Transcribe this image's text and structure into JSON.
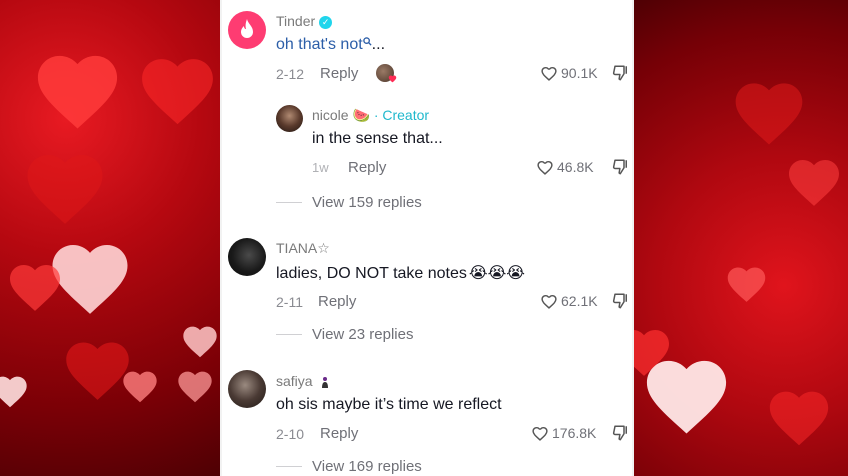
{
  "comments": [
    {
      "username": "Tinder",
      "text": "oh that's not",
      "text_suffix": "...",
      "date": "2-12",
      "reply_label": "Reply",
      "likes": "90.1K",
      "verified": true
    },
    {
      "username": "nicole",
      "emoji": "🍉",
      "badge": "· Creator",
      "text": "in the sense that...",
      "date": "1w",
      "reply_label": "Reply",
      "likes": "46.8K",
      "view_replies": "View 159 replies"
    },
    {
      "username": "TIANA☆",
      "text": "ladies, DO NOT take notes",
      "text_emoji": "😭😭😭",
      "date": "2-11",
      "reply_label": "Reply",
      "likes": "62.1K",
      "view_replies": "View 23 replies"
    },
    {
      "username": "safiya",
      "text": "oh sis maybe it’s time we reflect",
      "date": "2-10",
      "reply_label": "Reply",
      "likes": "176.8K",
      "view_replies": "View 169 replies"
    }
  ],
  "colors": {
    "tinder_brand": "#fe3c72",
    "creator_badge": "#20b8cc",
    "verified": "#20d5ec",
    "background_red": "#b50810"
  },
  "icons": [
    "flame-icon",
    "verified-icon",
    "search-icon",
    "heart-icon",
    "dislike-icon"
  ]
}
